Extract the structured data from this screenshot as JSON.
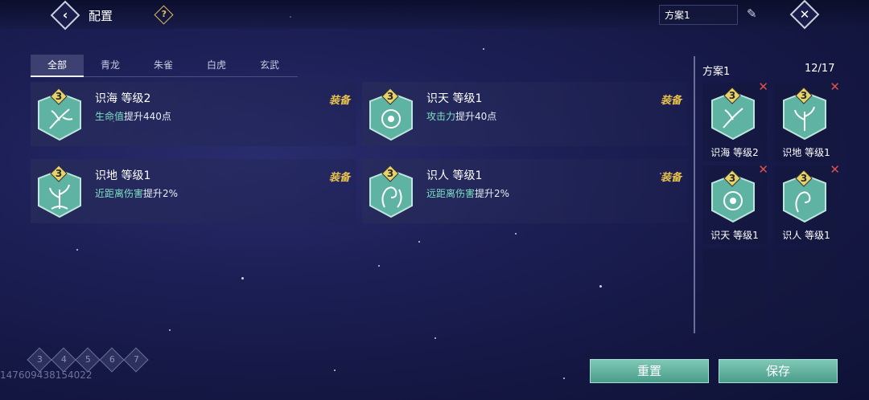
{
  "header": {
    "title": "配置",
    "plan_name_value": "方案1"
  },
  "tabs": [
    "全部",
    "青龙",
    "朱雀",
    "白虎",
    "玄武"
  ],
  "cards": [
    {
      "name": "识海 等级2",
      "stat": "生命值",
      "effect": "提升440点",
      "equip": "装备",
      "level": "3",
      "icon": "branch-icon"
    },
    {
      "name": "识天 等级1",
      "stat": "攻击力",
      "effect": "提升40点",
      "equip": "装备",
      "level": "3",
      "icon": "orb-icon"
    },
    {
      "name": "识地 等级1",
      "stat": "近距离伤害",
      "effect": "提升2%",
      "equip": "装备",
      "level": "3",
      "icon": "tree-icon"
    },
    {
      "name": "识人 等级1",
      "stat": "远距离伤害",
      "effect": "提升2%",
      "equip": "装备",
      "level": "3",
      "icon": "swirl-icon"
    }
  ],
  "side": {
    "plan_title": "方案1",
    "count": "12/17",
    "slots": [
      {
        "label": "识海 等级2",
        "level": "3"
      },
      {
        "label": "识地 等级1",
        "level": "3"
      },
      {
        "label": "识天 等级1",
        "level": "3"
      },
      {
        "label": "识人 等级1",
        "level": "3"
      }
    ]
  },
  "pages": [
    "3",
    "4",
    "5",
    "6",
    "7"
  ],
  "uid": "1476094381540​22",
  "buttons": {
    "reset": "重置",
    "save": "保存"
  },
  "colors": {
    "accent": "#7ee0c4",
    "equip": "#e8c24a",
    "badge": "#5fb3a3",
    "remove": "#e05050"
  }
}
